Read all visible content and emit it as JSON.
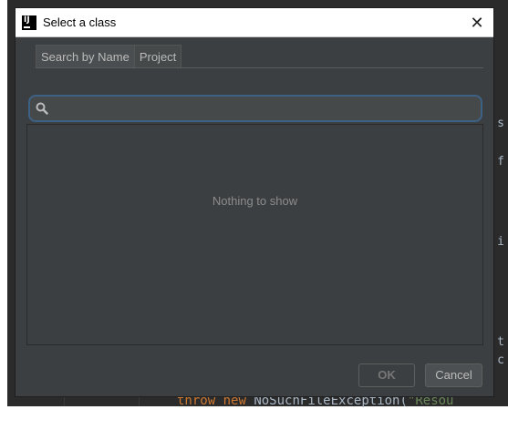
{
  "dialog": {
    "title": "Select a class",
    "close_glyph": "✕",
    "app_icon": "intellij-logo-icon",
    "app_icon_text": "IJ"
  },
  "tabs": [
    {
      "label": "Search by Name",
      "active": true
    },
    {
      "label": "Project",
      "active": false
    }
  ],
  "search": {
    "value": "",
    "placeholder": "",
    "icon": "search-icon"
  },
  "results": {
    "empty_text": "Nothing to show"
  },
  "buttons": {
    "ok_label": "OK",
    "ok_enabled": false,
    "cancel_label": "Cancel"
  },
  "background_editor": {
    "code_keyword1": "throw",
    "code_keyword2": "new",
    "code_text": "NoSuchFileException(",
    "code_string": "\"Resou",
    "edge_chars": [
      "s",
      "f",
      "i",
      "t",
      "c"
    ]
  },
  "colors": {
    "dialog_bg": "#3c3f41",
    "focus_border": "#3d6185",
    "editor_bg": "#2b2b2b"
  }
}
